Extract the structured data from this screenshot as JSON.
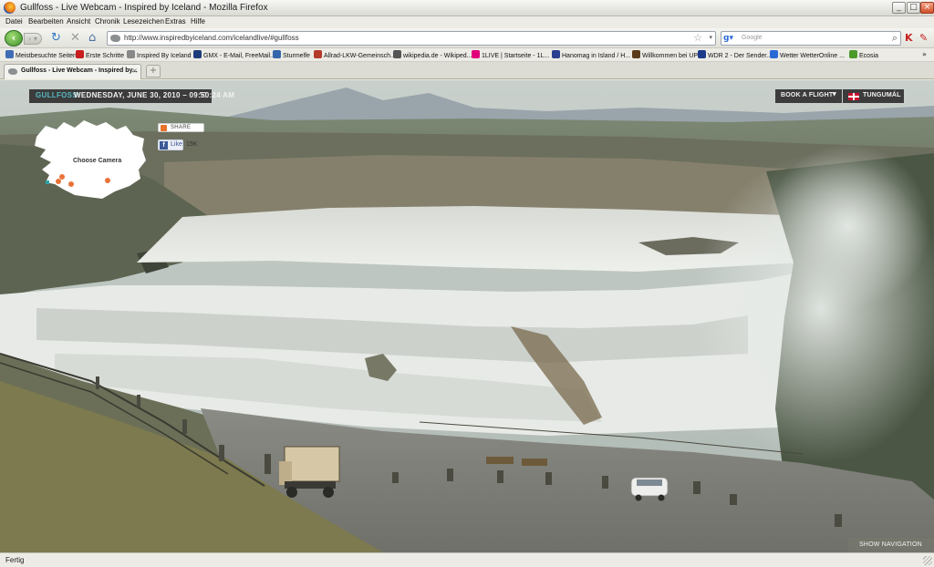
{
  "window": {
    "title": "Gullfoss - Live Webcam - Inspired by Iceland - Mozilla Firefox"
  },
  "menu": {
    "items": [
      "Datei",
      "Bearbeiten",
      "Ansicht",
      "Chronik",
      "Lesezeichen",
      "Extras",
      "Hilfe"
    ]
  },
  "navbar": {
    "url": "http://www.inspiredbyiceland.com/icelandlive/#gullfoss",
    "search_placeholder": "Google"
  },
  "bookmarks": [
    {
      "label": "Meistbesuchte Seiten",
      "color": "#3e6db5"
    },
    {
      "label": "Erste Schritte",
      "color": "#c81e1e"
    },
    {
      "label": "Inspired By Iceland",
      "color": "#888888"
    },
    {
      "label": "GMX - E-Mail, FreeMail...",
      "color": "#1d3a7a"
    },
    {
      "label": "Sturmelfe",
      "color": "#3366aa"
    },
    {
      "label": "Allrad-LKW-Gemeinsch...",
      "color": "#b43a2a"
    },
    {
      "label": "wikipedia.de - Wikiped...",
      "color": "#555555"
    },
    {
      "label": "1LIVE | Startseite - 1L...",
      "color": "#e2007a"
    },
    {
      "label": "Hanomag in Island / H...",
      "color": "#2a3f8f"
    },
    {
      "label": "Willkommen bei UPS",
      "color": "#5b3a1a"
    },
    {
      "label": "WDR 2 - Der Sender...",
      "color": "#1a3a8a"
    },
    {
      "label": "Wetter WetterOnline ...",
      "color": "#2a6ad6"
    },
    {
      "label": "Ecosia",
      "color": "#4a9a2a"
    }
  ],
  "tab": {
    "label": "Gullfoss - Live Webcam - Inspired by..."
  },
  "page": {
    "location": "GULLFOSS:",
    "datetime": "WEDNESDAY, JUNE 30, 2010 – 09:50:24 AM",
    "book_flight": "BOOK A FLIGHT",
    "language": "TUNGUMÁL",
    "map_label": "Choose Camera",
    "share": "SHARE",
    "like": "Like",
    "like_count": "15K",
    "show_navigation": "SHOW NAVIGATION"
  },
  "status": {
    "text": "Fertig"
  },
  "colors": {
    "accent_location": "#56b8c2",
    "overlay_bg": "#282828"
  }
}
